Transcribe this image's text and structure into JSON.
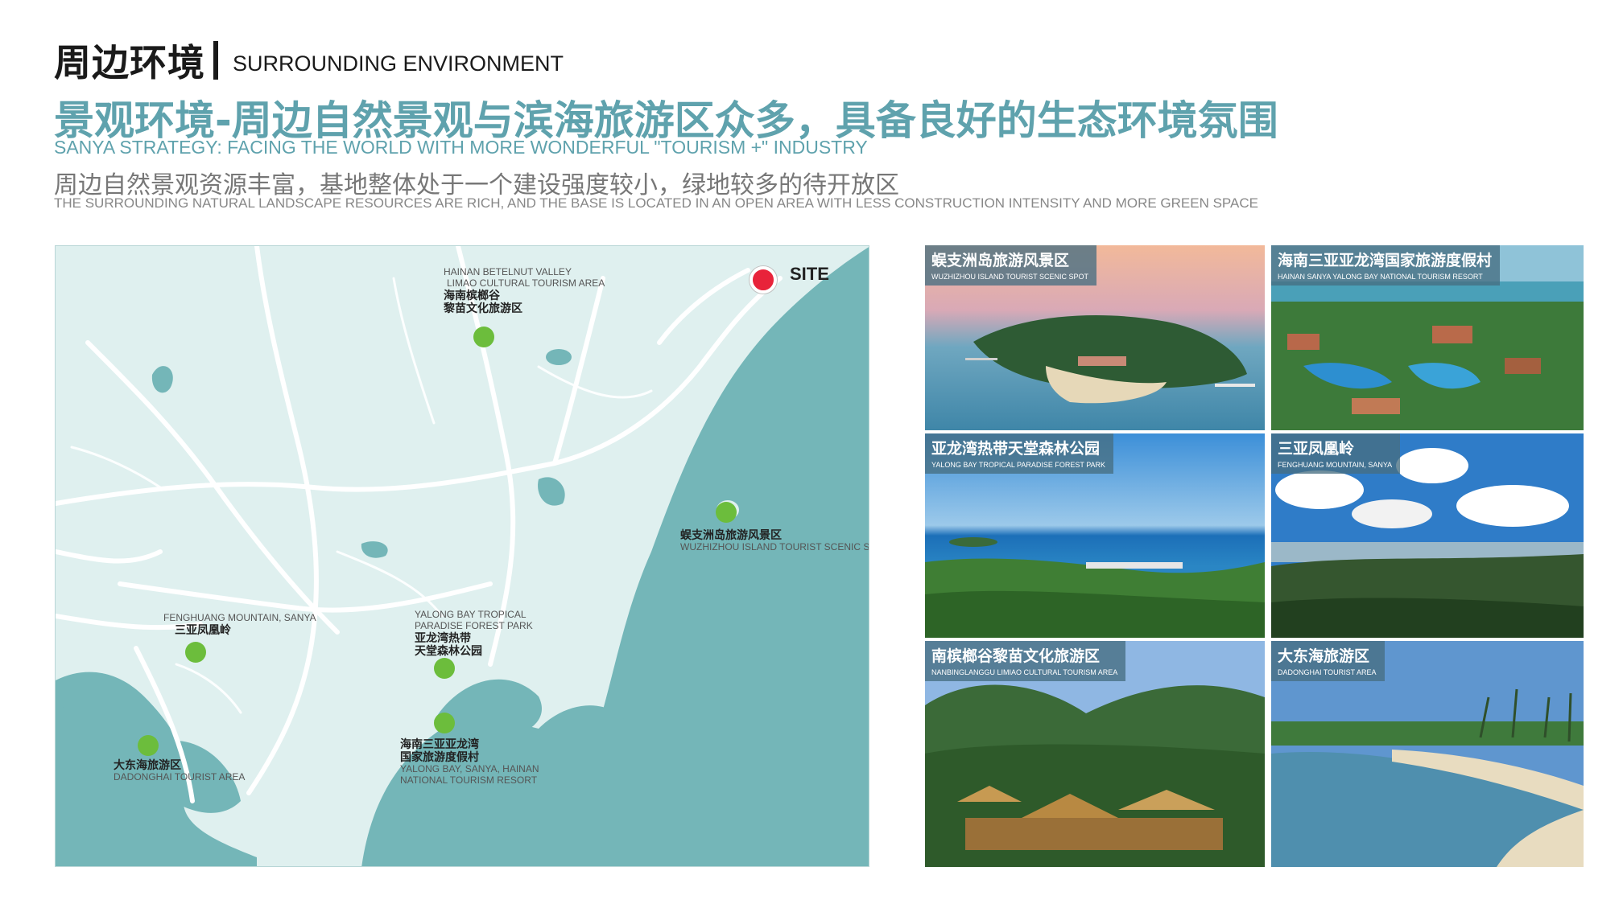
{
  "header": {
    "title_zh": "周边环境",
    "title_en": "SURROUNDING ENVIRONMENT"
  },
  "headline": "景观环境-周边自然景观与滨海旅游区众多，具备良好的生态环境氛围",
  "subtitle_en": "SANYA STRATEGY: FACING THE WORLD WITH MORE WONDERFUL \"TOURISM +\" INDUSTRY",
  "description_zh": "周边自然景观资源丰富，基地整体处于一个建设强度较小，绿地较多的待开放区",
  "description_en": "THE SURROUNDING NATURAL LANDSCAPE RESOURCES ARE RICH, AND THE BASE IS LOCATED IN AN OPEN AREA WITH LESS CONSTRUCTION INTENSITY AND MORE GREEN SPACE",
  "map": {
    "site_label": "SITE",
    "pois": [
      {
        "en1": "HAINAN BETELNUT VALLEY",
        "en2": "LIMAO CULTURAL TOURISM AREA",
        "zh1": "海南槟榔谷",
        "zh2": "黎苗文化旅游区"
      },
      {
        "zh1": "蜈支洲岛旅游风景区",
        "en1": "WUZHIZHOU ISLAND TOURIST SCENIC SPOT"
      },
      {
        "en1": "FENGHUANG MOUNTAIN, SANYA",
        "zh1": "三亚凤凰岭"
      },
      {
        "en1": "YALONG BAY TROPICAL",
        "en2": "PARADISE FOREST PARK",
        "zh1": "亚龙湾热带",
        "zh2": "天堂森林公园"
      },
      {
        "zh1": "海南三亚亚龙湾",
        "zh2": "国家旅游度假村",
        "en1": "YALONG BAY, SANYA, HAINAN",
        "en2": "NATIONAL TOURISM RESORT"
      },
      {
        "zh1": "大东海旅游区",
        "en1": "DADONGHAI TOURIST AREA"
      }
    ],
    "colors": {
      "land": "#dff0ef",
      "water": "#74b6b8",
      "road": "#ffffff",
      "poi": "#6cbd3c",
      "site": "#e8233a"
    }
  },
  "photos": [
    {
      "zh": "蜈支洲岛旅游风景区",
      "en": "WUZHIZHOU ISLAND TOURIST SCENIC SPOT"
    },
    {
      "zh": "海南三亚亚龙湾国家旅游度假村",
      "en": "HAINAN SANYA YALONG BAY NATIONAL TOURISM RESORT"
    },
    {
      "zh": "亚龙湾热带天堂森林公园",
      "en": "YALONG BAY TROPICAL PARADISE FOREST PARK"
    },
    {
      "zh": "三亚凤凰岭",
      "en": "FENGHUANG MOUNTAIN, SANYA"
    },
    {
      "zh": "南槟榔谷黎苗文化旅游区",
      "en": "NANBINGLANGGU LIMIAO CULTURAL TOURISM AREA"
    },
    {
      "zh": "大东海旅游区",
      "en": "DADONGHAI TOURIST AREA"
    }
  ]
}
